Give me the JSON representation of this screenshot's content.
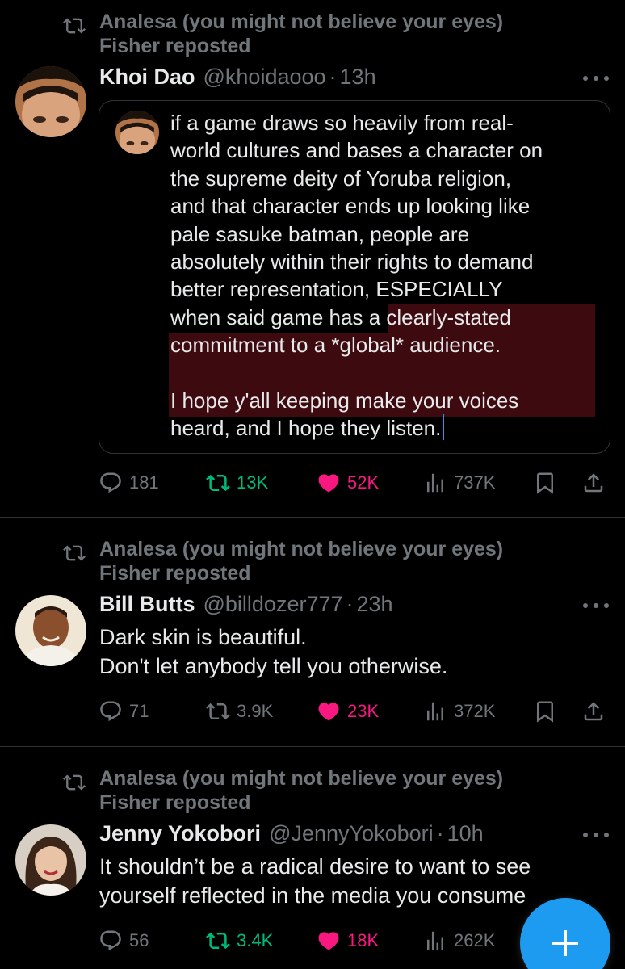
{
  "colors": {
    "background": "#000000",
    "text": "#e7e9ea",
    "muted": "#71767b",
    "retweet_green": "#00ba7c",
    "like_pink": "#f91880",
    "accent_blue": "#1d9bf0",
    "highlight": "#3d0a0f"
  },
  "posts": [
    {
      "repost_line1": "Analesa (you might not believe your eyes)",
      "repost_line2": "Fisher reposted",
      "name": "Khoi Dao",
      "handle": "@khoidaooo",
      "dot": "·",
      "time": "13h",
      "quote_text": "if a game draws so heavily from real-\nworld cultures and bases a character on\nthe supreme deity of Yoruba religion,\nand that character ends up looking like\npale sasuke batman, people are\nabsolutely within their rights to demand\nbetter representation, ESPECIALLY\nwhen said game  has a clearly-stated\ncommitment to a *global* audience.\n\nI hope y'all keeping make your voices\nheard, and I hope they listen.",
      "replies": "181",
      "reposts": "13K",
      "likes": "52K",
      "views": "737K",
      "liked": true,
      "reposted": true
    },
    {
      "repost_line1": "Analesa (you might not believe your eyes)",
      "repost_line2": "Fisher reposted",
      "name": "Bill Butts",
      "handle": "@billdozer777",
      "dot": "·",
      "time": "23h",
      "text_line1": "Dark skin is beautiful.",
      "text_line2": "Don't let anybody tell you otherwise.",
      "replies": "71",
      "reposts": "3.9K",
      "likes": "23K",
      "views": "372K",
      "liked": true,
      "reposted": false
    },
    {
      "repost_line1": "Analesa (you might not believe your eyes)",
      "repost_line2": "Fisher reposted",
      "name": "Jenny Yokobori",
      "handle": "@JennyYokobori",
      "dot": "·",
      "time": "10h",
      "text_line1": "It shouldn’t be a radical desire to want to see",
      "text_line2": "yourself reflected in the media you consume",
      "replies": "56",
      "reposts": "3.4K",
      "likes": "18K",
      "views": "262K",
      "liked": true,
      "reposted": true
    }
  ],
  "icons": {
    "repost": "repost-icon",
    "more": "more-icon",
    "reply": "reply-icon",
    "like": "heart-icon",
    "views": "views-icon",
    "bookmark": "bookmark-icon",
    "share": "share-icon",
    "compose": "plus-icon"
  }
}
